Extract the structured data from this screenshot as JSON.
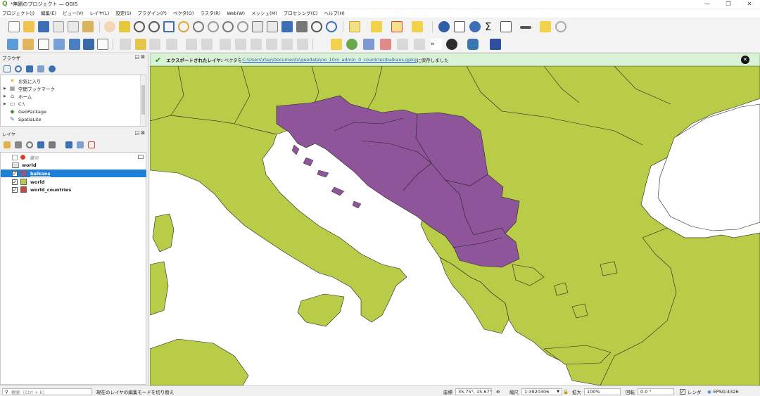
{
  "window": {
    "title": "*無題のプロジェクト — QGIS",
    "app_icon": "qgis-icon",
    "controls": [
      "—",
      "❐",
      "✕"
    ]
  },
  "menu": [
    "プロジェクト(J)",
    "編集(E)",
    "ビュー(V)",
    "レイヤ(L)",
    "設定(S)",
    "プラグイン(P)",
    "ベクタ(O)",
    "ラスタ(R)",
    "Web(W)",
    "メッシュ(M)",
    "プロセシング(C)",
    "ヘルプ(H)"
  ],
  "browser_panel": {
    "title": "ブラウザ",
    "header_buttons": "◲⊠",
    "items": [
      {
        "icon": "star-icon",
        "glyph": "★",
        "label": "お気に入り",
        "expandable": false
      },
      {
        "icon": "bookmark-icon",
        "glyph": "▦",
        "label": "空間ブックマーク",
        "expandable": true
      },
      {
        "icon": "home-icon",
        "glyph": "⌂",
        "label": "ホーム",
        "expandable": true
      },
      {
        "icon": "folder-icon",
        "glyph": "▭",
        "label": "C:\\",
        "expandable": true
      },
      {
        "icon": "geopackage-icon",
        "glyph": "◆",
        "label": "GeoPackage",
        "expandable": false
      },
      {
        "icon": "spatialite-icon",
        "glyph": "✎",
        "label": "SpatiaLite",
        "expandable": false
      }
    ]
  },
  "layers_panel": {
    "title": "レイヤ",
    "header_buttons": "◲⊠",
    "layers": [
      {
        "name": "震央",
        "checked": false,
        "swatch": "#e0402a",
        "style": "point",
        "selected": false,
        "italic": true
      },
      {
        "name": "world",
        "checked": null,
        "swatch": "",
        "style": "table",
        "selected": false,
        "italic": false
      },
      {
        "name": "balkans",
        "checked": true,
        "swatch": "#8f559a",
        "style": "fill",
        "selected": true,
        "italic": false
      },
      {
        "name": "world",
        "checked": true,
        "swatch": "#b9cc47",
        "style": "fill",
        "selected": false,
        "italic": false
      },
      {
        "name": "world_countries",
        "checked": true,
        "swatch": "#d6413a",
        "style": "fill",
        "selected": false,
        "italic": false
      }
    ]
  },
  "message_bar": {
    "title": "エクスポートされたレイヤ:",
    "prefix": " ベクタを",
    "link": "C:\\Users\\rlay\\Documents\\geodata\\ne_10m_admin_0_countries\\balkans.gpkg",
    "suffix": "に保存しました",
    "close_glyph": "✕"
  },
  "map": {
    "sea_color": "#ffffff",
    "land_color": "#b9cc47",
    "highlight_color": "#8f559a",
    "border_color": "#222222"
  },
  "statusbar": {
    "search_placeholder": "検索（Ctrl + K）",
    "hint": "現在のレイヤの編集モードを切り替え",
    "coord_label": "座標",
    "coord_value": "35.75°, 15.67°",
    "scale_label": "縮尺",
    "scale_value": "1:3920306",
    "magnifier_label": "拡大",
    "magnifier_value": "100%",
    "rotation_label": "回転",
    "rotation_value": "0.0 °",
    "render_label": "レンダ",
    "crs_label": "EPSG:4326"
  }
}
